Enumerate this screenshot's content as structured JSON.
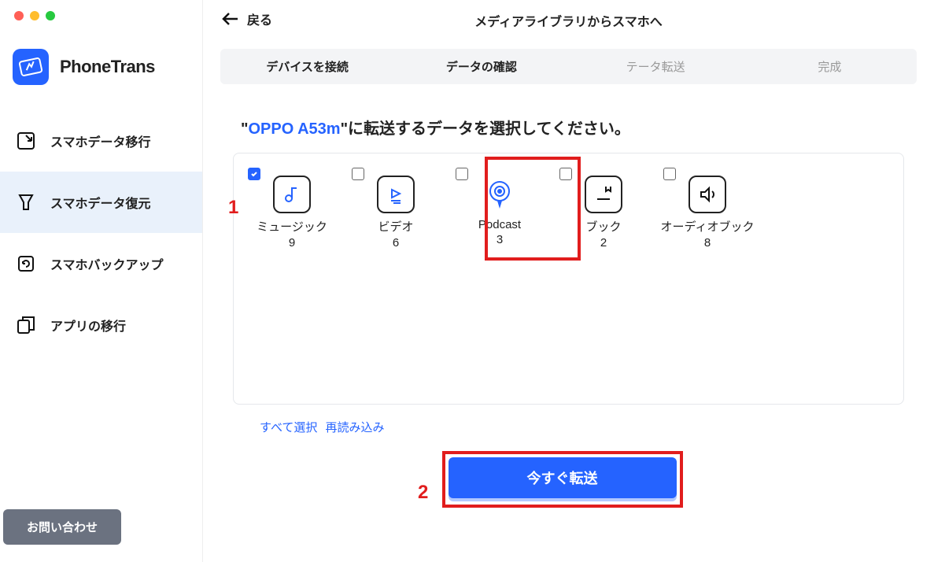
{
  "app_name": "PhoneTrans",
  "traffic_colors": {
    "r": "#ff5f56",
    "y": "#ffbd2e",
    "g": "#27c93f"
  },
  "sidebar": {
    "items": [
      {
        "label": "スマホデータ移行"
      },
      {
        "label": "スマホデータ復元"
      },
      {
        "label": "スマホバックアップ"
      },
      {
        "label": "アプリの移行"
      }
    ],
    "contact_label": "お問い合わせ"
  },
  "header": {
    "back_label": "戻る",
    "title": "メディアライブラリからスマホへ"
  },
  "steps": [
    {
      "label": "デバイスを接続",
      "state": "done"
    },
    {
      "label": "データの確認",
      "state": "current"
    },
    {
      "label": "テータ転送",
      "state": "pending"
    },
    {
      "label": "完成",
      "state": "pending"
    }
  ],
  "instruction": {
    "prefix": "\"",
    "device": "OPPO A53m",
    "suffix": "\"に転送するデータを選択してください。"
  },
  "data_types": [
    {
      "id": "music",
      "label": "ミュージック",
      "count": 9,
      "checked": true
    },
    {
      "id": "video",
      "label": "ビデオ",
      "count": 6,
      "checked": false
    },
    {
      "id": "podcast",
      "label": "Podcast",
      "count": 3,
      "checked": false
    },
    {
      "id": "book",
      "label": "ブック",
      "count": 2,
      "checked": false
    },
    {
      "id": "audiobook",
      "label": "オーディオブック",
      "count": 8,
      "checked": false
    }
  ],
  "links": {
    "select_all": "すべて選択",
    "reload": "再読み込み"
  },
  "transfer_label": "今すぐ転送",
  "annotations": {
    "one": "1",
    "two": "2"
  }
}
